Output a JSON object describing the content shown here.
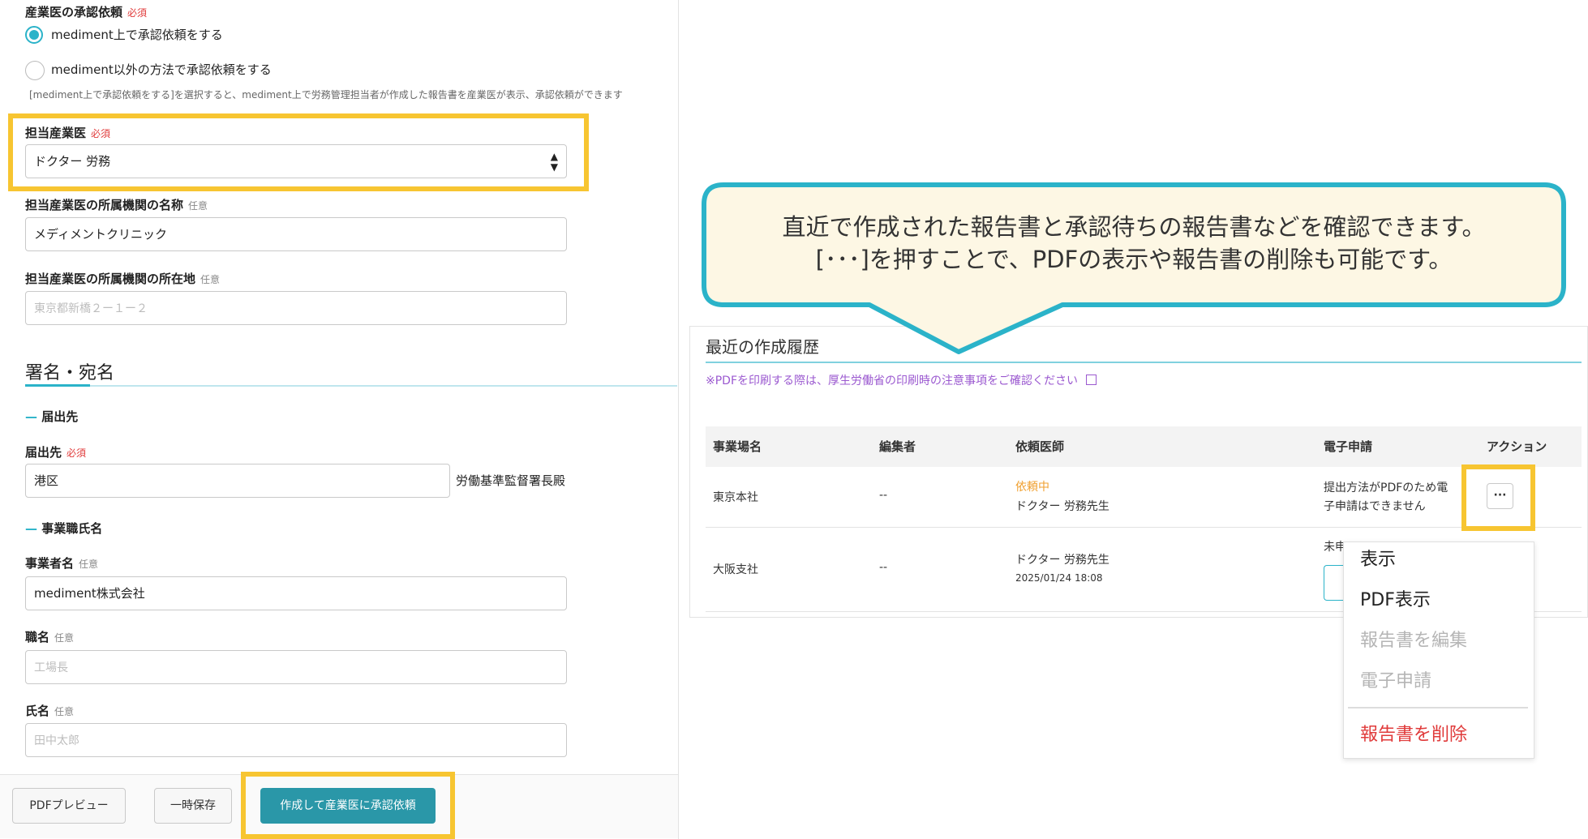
{
  "form": {
    "approval_label": "産業医の承認依頼",
    "required": "必須",
    "optional": "任意",
    "radio_option_1": "mediment上で承認依頼をする",
    "radio_option_2": "mediment以外の方法で承認依頼をする",
    "note": "[mediment上で承認依頼をする]を選択すると、mediment上で労務管理担当者が作成した報告書を産業医が表示、承認依頼ができます",
    "doctor_label": "担当産業医",
    "doctor_value": "ドクター 労務",
    "institution_name_label": "担当産業医の所属機関の名称",
    "institution_name_value": "メディメントクリニック",
    "institution_address_label": "担当産業医の所属機関の所在地",
    "institution_address_placeholder": "東京都新橋２ー１ー２",
    "signature_section_title": "署名・宛名",
    "destination_section": "届出先",
    "destination_label": "届出先",
    "destination_value": "港区",
    "destination_suffix": "労働基準監督署長殿",
    "employer_section": "事業職氏名",
    "employer_name_label": "事業者名",
    "employer_name_value": "mediment株式会社",
    "job_title_label": "職名",
    "job_title_placeholder": "工場長",
    "person_name_label": "氏名",
    "person_name_placeholder": "田中太郎"
  },
  "footer": {
    "pdf_preview": "PDFプレビュー",
    "save_draft": "一時保存",
    "create_and_request": "作成して産業医に承認依頼"
  },
  "callout": {
    "line1": "直近で作成された報告書と承認待ちの報告書などを確認できます。",
    "line2": "[･･･]を押すことで、PDFの表示や報告書の削除も可能です。"
  },
  "history": {
    "title": "最近の作成履歴",
    "notice": "※PDFを印刷する際は、厚生労働省の印刷時の注意事項をご確認ください",
    "columns": [
      "事業場名",
      "編集者",
      "依頼医師",
      "電子申請",
      "アクション"
    ],
    "rows": [
      {
        "site": "東京本社",
        "editor": "--",
        "status": "依頼中",
        "doctor": "ドクター 労務先生",
        "date": "",
        "esub_line1": "提出方法がPDFのため電",
        "esub_line2": "子申請はできません"
      },
      {
        "site": "大阪支社",
        "editor": "--",
        "status": "",
        "doctor": "ドクター 労務先生",
        "date": "2025/01/24 18:08",
        "esub_line1": "未申",
        "esub_line2": ""
      }
    ],
    "action_button": "···"
  },
  "menu": {
    "view": "表示",
    "pdf_view": "PDF表示",
    "edit": "報告書を編集",
    "e_submit": "電子申請",
    "delete": "報告書を削除"
  },
  "colors": {
    "accent": "#2bb3c9",
    "highlight": "#f7c531",
    "primary_button": "#2a97a8",
    "danger": "#e03a3a",
    "status_pending": "#f0a030",
    "link": "#9b59d0"
  }
}
